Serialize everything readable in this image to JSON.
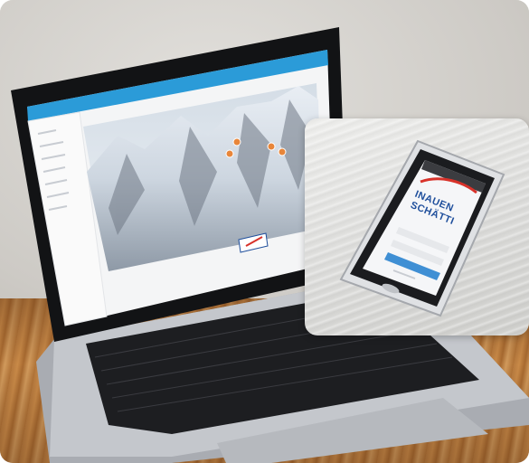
{
  "scene": {
    "description_free": true,
    "colors": {
      "laptop_screen_header": "#2b9bd8",
      "phone_brand": "#1f4f9c",
      "phone_accent": "#d8322a",
      "phone_button": "#3f8fd4"
    }
  },
  "laptop": {
    "app_logo": "",
    "sidebar_items": [
      "",
      "",
      "",
      "",
      "",
      "",
      ""
    ],
    "page_heading": ""
  },
  "phone": {
    "brand_line1": "INAUEN",
    "brand_line2": "SCHÄTTI"
  },
  "icons": [
    "laptop-keyboard-icon",
    "map-pin-icon",
    "phone-icon"
  ]
}
